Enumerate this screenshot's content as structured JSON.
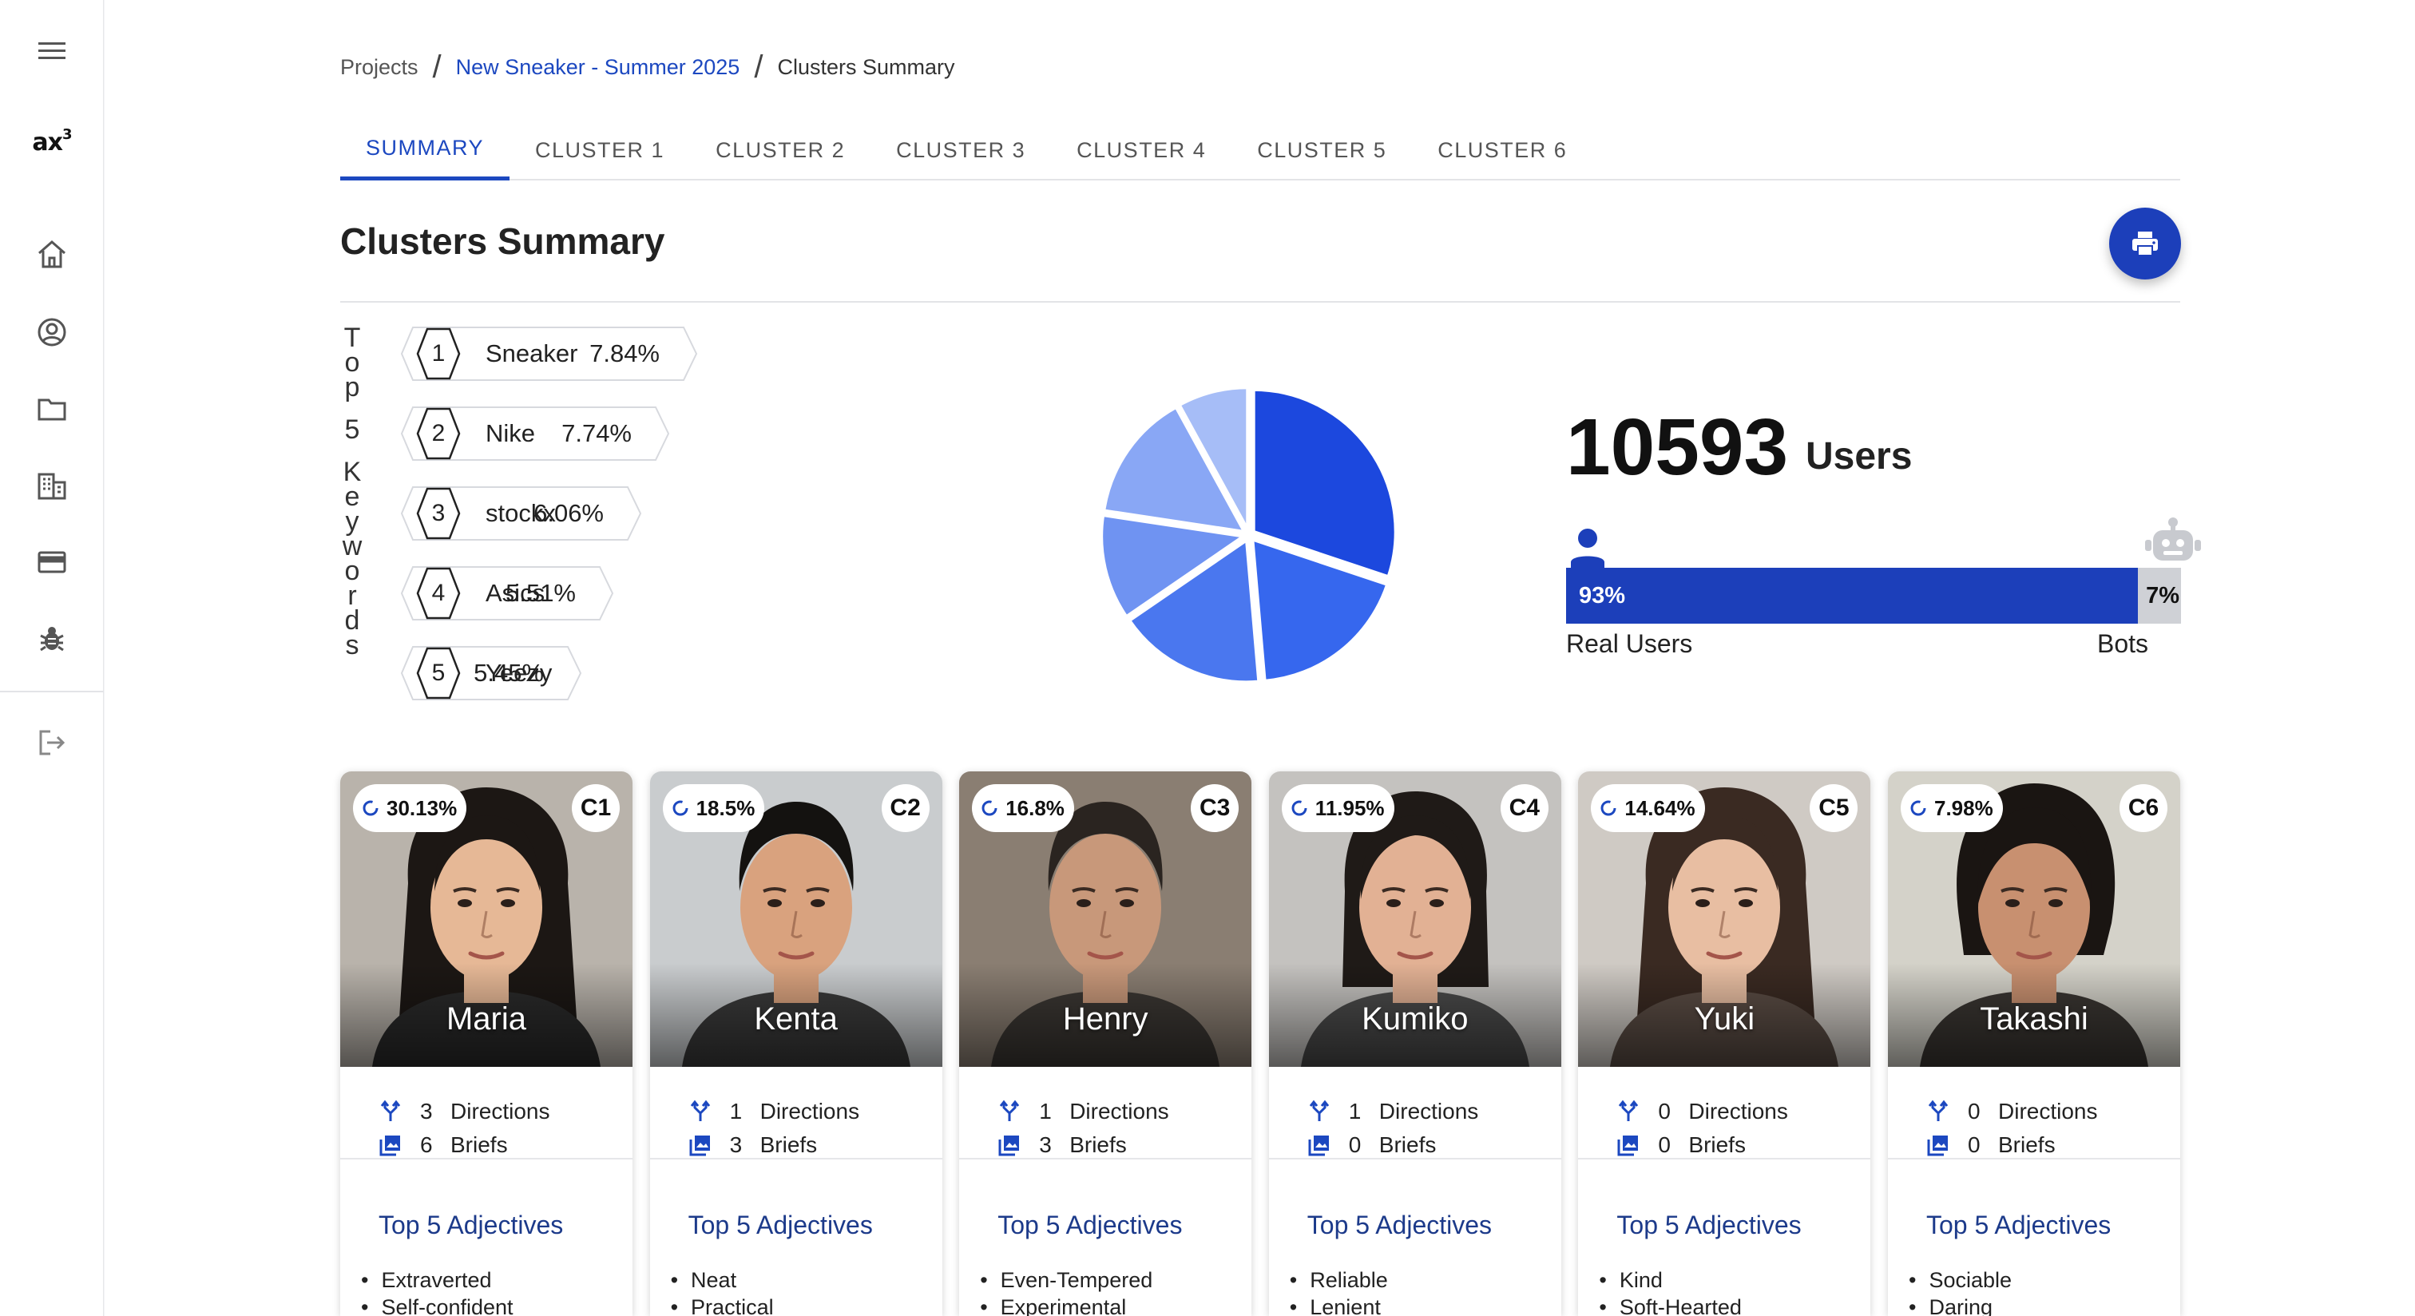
{
  "sidebar": {
    "logo_text": "ax",
    "logo_sup": "3",
    "icons": [
      "menu-icon",
      "home-icon",
      "account-icon",
      "folder-icon",
      "building-icon",
      "credit-card-icon",
      "bug-icon",
      "logout-icon"
    ]
  },
  "breadcrumb": {
    "items": [
      "Projects",
      "New Sneaker - Summer 2025",
      "Clusters Summary"
    ],
    "separator": "/"
  },
  "tabs": [
    "SUMMARY",
    "CLUSTER 1",
    "CLUSTER 2",
    "CLUSTER 3",
    "CLUSTER 4",
    "CLUSTER 5",
    "CLUSTER 6"
  ],
  "active_tab": "SUMMARY",
  "page_title": "Clusters Summary",
  "keywords": {
    "title_chars": [
      "T",
      "o",
      "p",
      "",
      "5",
      "",
      "K",
      "e",
      "y",
      "w",
      "o",
      "r",
      "d",
      "s"
    ],
    "items": [
      {
        "rank": "1",
        "label": "Sneaker",
        "pct": "7.84%"
      },
      {
        "rank": "2",
        "label": "Nike",
        "pct": "7.74%"
      },
      {
        "rank": "3",
        "label": "stockx",
        "pct": "6.06%"
      },
      {
        "rank": "4",
        "label": "Asics",
        "pct": "5.51%"
      },
      {
        "rank": "5",
        "label": "Yeezy",
        "pct": "5.45%"
      }
    ]
  },
  "chart_data": {
    "type": "pie",
    "categories": [
      "C1",
      "C2",
      "C3",
      "C4",
      "C5",
      "C6"
    ],
    "values": [
      30.13,
      18.5,
      16.8,
      11.95,
      14.64,
      7.98
    ],
    "colors": [
      "#1c48de",
      "#3667ee",
      "#4a77ef",
      "#6f93f2",
      "#89a7f5",
      "#a6bdf7"
    ]
  },
  "users": {
    "count": "10593",
    "label": "Users",
    "real_pct_value": 93,
    "real_pct": "93%",
    "bot_pct": "7%",
    "real_label": "Real Users",
    "bot_label": "Bots"
  },
  "clusters": [
    {
      "id": "C1",
      "pct": "30.13%",
      "name": "Maria",
      "directions": "3",
      "briefs": "6",
      "adjectives": [
        "Extraverted",
        "Self-confident"
      ],
      "skin": "#e6b896",
      "hair": "#1c1714",
      "bg": "#b9b3ab",
      "shirt": "#2a2a2a",
      "hair_style": "long"
    },
    {
      "id": "C2",
      "pct": "18.5%",
      "name": "Kenta",
      "directions": "1",
      "briefs": "3",
      "adjectives": [
        "Neat",
        "Practical"
      ],
      "skin": "#d9a27e",
      "hair": "#141210",
      "bg": "#c9ccce",
      "shirt": "#3a3a3a",
      "hair_style": "short"
    },
    {
      "id": "C3",
      "pct": "16.8%",
      "name": "Henry",
      "directions": "1",
      "briefs": "3",
      "adjectives": [
        "Even-Tempered",
        "Experimental"
      ],
      "skin": "#c8987a",
      "hair": "#2a2420",
      "bg": "#8a7e72",
      "shirt": "#3b3733",
      "hair_style": "short"
    },
    {
      "id": "C4",
      "pct": "11.95%",
      "name": "Kumiko",
      "directions": "1",
      "briefs": "0",
      "adjectives": [
        "Reliable",
        "Lenient"
      ],
      "skin": "#e2b194",
      "hair": "#1f1a17",
      "bg": "#c4c2bf",
      "shirt": "#4a4a4a",
      "hair_style": "bob"
    },
    {
      "id": "C5",
      "pct": "14.64%",
      "name": "Yuki",
      "directions": "0",
      "briefs": "0",
      "adjectives": [
        "Kind",
        "Soft-Hearted"
      ],
      "skin": "#e8bea2",
      "hair": "#3a2a22",
      "bg": "#cfcac4",
      "shirt": "#5a4c44",
      "hair_style": "long"
    },
    {
      "id": "C6",
      "pct": "7.98%",
      "name": "Takashi",
      "directions": "0",
      "briefs": "0",
      "adjectives": [
        "Sociable",
        "Daring"
      ],
      "skin": "#c89070",
      "hair": "#1a1512",
      "bg": "#d4d2c9",
      "shirt": "#3a3632",
      "hair_style": "curly"
    }
  ],
  "labels": {
    "directions": "Directions",
    "briefs": "Briefs",
    "adjectives_title": "Top 5 Adjectives"
  }
}
